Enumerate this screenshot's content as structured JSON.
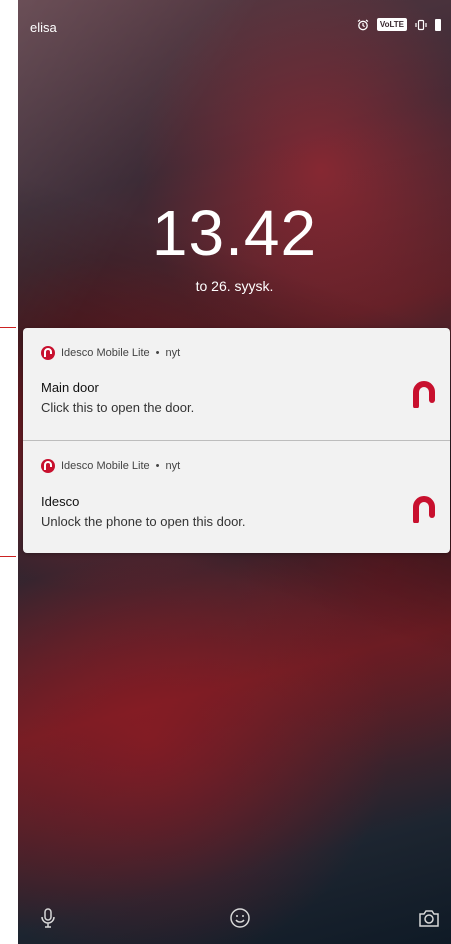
{
  "status_bar": {
    "carrier": "elisa",
    "icons": [
      "alarm-icon",
      "volte-badge",
      "vibrate-icon",
      "battery-icon"
    ],
    "volte_label": "VoLTE"
  },
  "lockscreen": {
    "time": "13.42",
    "date": "to 26. syysk."
  },
  "notifications": [
    {
      "app_name": "Idesco Mobile Lite",
      "separator": "•",
      "age": "nyt",
      "title": "Main door",
      "text": "Click this to open the door.",
      "icon": "idesco-logo-icon"
    },
    {
      "app_name": "Idesco Mobile Lite",
      "separator": "•",
      "age": "nyt",
      "title": "Idesco",
      "text": "Unlock the phone to open this door.",
      "icon": "idesco-logo-icon"
    }
  ],
  "bottom_bar": {
    "left": "microphone-icon",
    "center": "smiley-icon",
    "right": "camera-icon"
  },
  "colors": {
    "brand_red": "#c8102e",
    "notification_bg": "#f2f2f2"
  }
}
